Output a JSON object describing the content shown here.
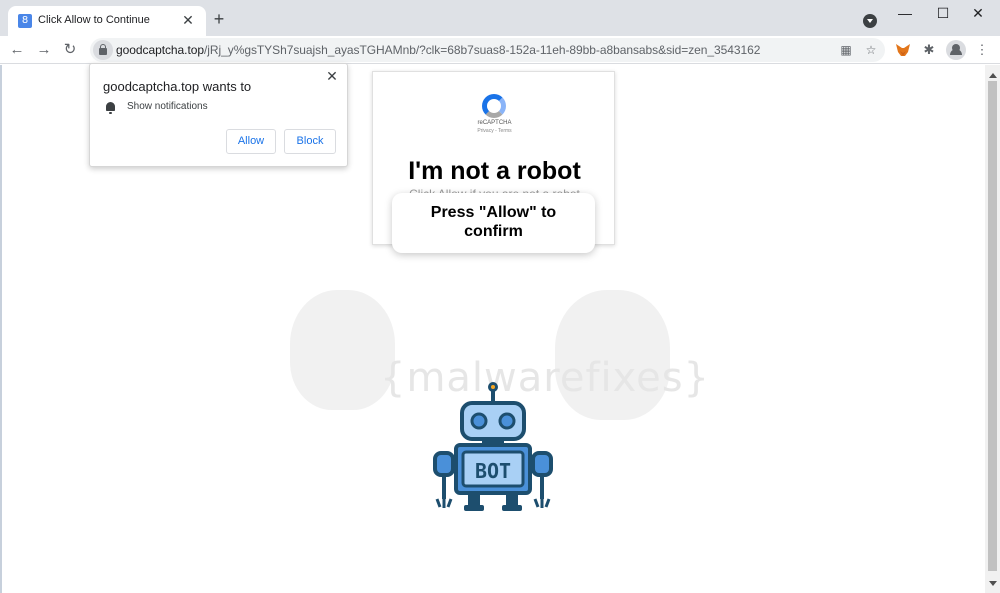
{
  "browser": {
    "tab_title": "Click Allow to Continue",
    "tab_close": "✕",
    "new_tab": "+",
    "url_host": "goodcaptcha.top",
    "url_rest": "/jRj_y%gsTYSh7suajsh_ayasTGHAMnb/?clk=68b7suas8-152a-11eh-89bb-a8bansabs&sid=zen_3543162",
    "back": "←",
    "forward": "→",
    "reload": "↻",
    "minimize": "—",
    "maximize": "☐",
    "close": "✕",
    "star": "☆",
    "qr": "▦",
    "extensions": "✱",
    "menu": "⋮"
  },
  "permission_prompt": {
    "title": "goodcaptcha.top wants to",
    "permission": "Show notifications",
    "allow_label": "Allow",
    "block_label": "Block",
    "close": "✕"
  },
  "captcha": {
    "brand": "reCAPTCHA",
    "brand_sub": "Privacy - Terms",
    "heading": "I'm not a robot",
    "subtext": "Click Allow if you are not a robot",
    "confirm_line1": "Press \"Allow\" to",
    "confirm_line2": "confirm"
  },
  "robot": {
    "label": "BOT"
  },
  "watermark": {
    "text": "{malwarefixes}"
  },
  "colors": {
    "accent": "#1a73e8",
    "robot_dark": "#1d4e6e",
    "robot_light": "#a9d0f5",
    "robot_mid": "#4a90d9"
  }
}
